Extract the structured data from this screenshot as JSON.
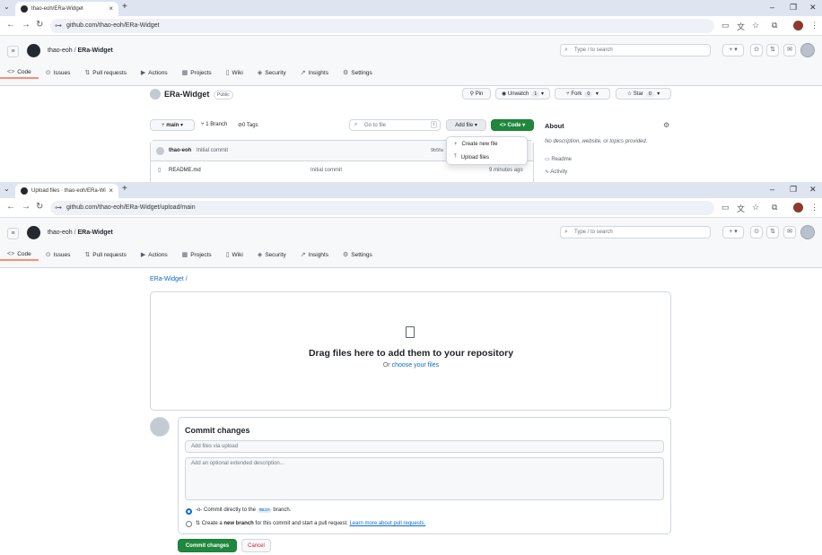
{
  "top": {
    "tab_title": "thao-eoh/ERa-Widget",
    "url": "github.com/thao-eoh/ERa-Widget",
    "owner": "thao-eoh",
    "sep": "/",
    "repo": "ERa-Widget",
    "search_placeholder": "Type / to search",
    "repo_tabs": [
      "Code",
      "Issues",
      "Pull requests",
      "Actions",
      "Projects",
      "Wiki",
      "Security",
      "Insights",
      "Settings"
    ],
    "repo_name": "ERa-Widget",
    "visibility": "Public",
    "pin": "Pin",
    "unwatch": "Unwatch",
    "unwatch_count": "1",
    "fork": "Fork",
    "fork_count": "0",
    "star": "Star",
    "star_count": "0",
    "branch": "main",
    "branch_count": "1 Branch",
    "tag_count": "0 Tags",
    "goto_file": "Go to file",
    "goto_key": "t",
    "add_file": "Add file",
    "code_btn": "Code",
    "about": "About",
    "about_desc": "No description, website, or topics provided.",
    "readme_link": "Readme",
    "activity_link": "Activity",
    "commit_author": "thao-eoh",
    "commit_msg": "Initial commit",
    "commit_hash": "9b5fa",
    "file_name": "README.md",
    "file_commit": "Initial commit",
    "file_time": "9 minutes ago",
    "dropdown": [
      "Create new file",
      "Upload files"
    ]
  },
  "bottom": {
    "tab_title": "Upload files · thao-eoh/ERa-Wi",
    "url": "github.com/thao-eoh/ERa-Widget/upload/main",
    "owner": "thao-eoh",
    "sep": "/",
    "repo": "ERa-Widget",
    "search_placeholder": "Type / to search",
    "repo_tabs": [
      "Code",
      "Issues",
      "Pull requests",
      "Actions",
      "Projects",
      "Wiki",
      "Security",
      "Insights",
      "Settings"
    ],
    "path_repo": "ERa-Widget",
    "path_sep": "/",
    "drop_title": "Drag files here to add them to your repository",
    "drop_or": "Or",
    "drop_choose": "choose your files",
    "commit_heading": "Commit changes",
    "summary_placeholder": "Add files via upload",
    "desc_placeholder": "Add an optional extended description...",
    "opt1_pre": "Commit directly to the",
    "opt1_branch": "main",
    "opt1_post": "branch.",
    "opt2_pre": "Create a",
    "opt2_bold": "new branch",
    "opt2_post": "for this commit and start a pull request.",
    "opt2_link": "Learn more about pull requests.",
    "commit_button": "Commit changes",
    "cancel_button": "Cancel"
  },
  "colors": {
    "accent": "#1f883d",
    "link": "#0969da",
    "tab_underline": "#fd8c73"
  }
}
